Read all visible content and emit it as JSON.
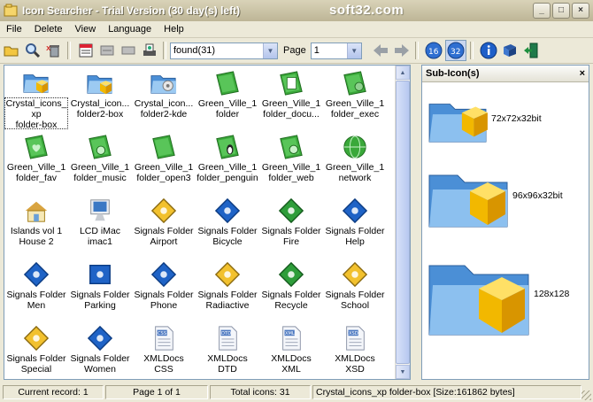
{
  "window": {
    "title": "Icon Searcher - Trial Version (30 day(s) left)",
    "watermark": "soft32.com"
  },
  "menu": [
    "File",
    "Delete",
    "View",
    "Language",
    "Help"
  ],
  "toolbar": {
    "filter_value": "found(31)",
    "page_label": "Page",
    "page_value": "1",
    "buttons": [
      "open-folder-icon",
      "search-icon",
      "delete-icon",
      "view-large-icon",
      "view-medium-icon",
      "view-small-icon",
      "scan-icon",
      "back-arrow-icon",
      "forward-arrow-icon",
      "size16-icon",
      "size32-icon",
      "info-icon",
      "help-book-icon",
      "exit-icon"
    ]
  },
  "icons": [
    {
      "label1": "Crystal_icons_",
      "label2": "xp",
      "label3": "folder-box",
      "kind": "crystal-box",
      "selected": true
    },
    {
      "label1": "Crystal_icon...",
      "label2": "folder2-box",
      "label3": "",
      "kind": "crystal-box2"
    },
    {
      "label1": "Crystal_icon...",
      "label2": "folder2-kde",
      "label3": "",
      "kind": "crystal-kde"
    },
    {
      "label1": "Green_Ville_1",
      "label2": "folder",
      "label3": "",
      "kind": "green-folder"
    },
    {
      "label1": "Green_Ville_1",
      "label2": "folder_docu...",
      "label3": "",
      "kind": "green-doc"
    },
    {
      "label1": "Green_Ville_1",
      "label2": "folder_exec",
      "label3": "",
      "kind": "green-exec"
    },
    {
      "label1": "Green_Ville_1",
      "label2": "folder_fav",
      "label3": "",
      "kind": "green-fav"
    },
    {
      "label1": "Green_Ville_1",
      "label2": "folder_music",
      "label3": "",
      "kind": "green-music"
    },
    {
      "label1": "Green_Ville_1",
      "label2": "folder_open3",
      "label3": "",
      "kind": "green-open"
    },
    {
      "label1": "Green_Ville_1",
      "label2": "folder_penguin",
      "label3": "",
      "kind": "green-penguin"
    },
    {
      "label1": "Green_Ville_1",
      "label2": "folder_web",
      "label3": "",
      "kind": "green-web"
    },
    {
      "label1": "Green_Ville_1",
      "label2": "network",
      "label3": "",
      "kind": "green-network"
    },
    {
      "label1": "Islands vol 1",
      "label2": "House 2",
      "label3": "",
      "kind": "house"
    },
    {
      "label1": "LCD iMac",
      "label2": "imac1",
      "label3": "",
      "kind": "imac"
    },
    {
      "label1": "Signals Folder",
      "label2": "Airport",
      "label3": "",
      "kind": "sig-yellow"
    },
    {
      "label1": "Signals Folder",
      "label2": "Bicycle",
      "label3": "",
      "kind": "sig-blue"
    },
    {
      "label1": "Signals Folder",
      "label2": "Fire",
      "label3": "",
      "kind": "sig-green"
    },
    {
      "label1": "Signals Folder",
      "label2": "Help",
      "label3": "",
      "kind": "sig-blue"
    },
    {
      "label1": "Signals Folder",
      "label2": "Men",
      "label3": "",
      "kind": "sig-blue"
    },
    {
      "label1": "Signals Folder",
      "label2": "Parking",
      "label3": "",
      "kind": "sig-bluesq"
    },
    {
      "label1": "Signals Folder",
      "label2": "Phone",
      "label3": "",
      "kind": "sig-blue"
    },
    {
      "label1": "Signals Folder",
      "label2": "Radiactive",
      "label3": "",
      "kind": "sig-yellow"
    },
    {
      "label1": "Signals Folder",
      "label2": "Recycle",
      "label3": "",
      "kind": "sig-green"
    },
    {
      "label1": "Signals Folder",
      "label2": "School",
      "label3": "",
      "kind": "sig-yellow"
    },
    {
      "label1": "Signals Folder",
      "label2": "Special",
      "label3": "",
      "kind": "sig-yellow"
    },
    {
      "label1": "Signals Folder",
      "label2": "Women",
      "label3": "",
      "kind": "sig-blue"
    },
    {
      "label1": "XMLDocs",
      "label2": "CSS",
      "label3": "",
      "kind": "doc",
      "tag": "CSS"
    },
    {
      "label1": "XMLDocs",
      "label2": "DTD",
      "label3": "",
      "kind": "doc",
      "tag": "DTD"
    },
    {
      "label1": "XMLDocs",
      "label2": "XML",
      "label3": "",
      "kind": "doc",
      "tag": "XML"
    },
    {
      "label1": "XMLDocs",
      "label2": "XSD",
      "label3": "",
      "kind": "doc",
      "tag": "XSD"
    }
  ],
  "subicons": {
    "title": "Sub-Icon(s)",
    "items": [
      {
        "label": "72x72x32bit"
      },
      {
        "label": "96x96x32bit"
      },
      {
        "label": "128x128"
      }
    ]
  },
  "status": {
    "record": "Current record: 1",
    "page": "Page 1 of 1",
    "total": "Total icons: 31",
    "info": "Crystal_icons_xp folder-box [Size:161862 bytes]"
  },
  "colors": {
    "accent": "#7f9db9",
    "folder_blue": "#5f9fd8",
    "box_yellow": "#f2b800",
    "green": "#3aa83a"
  }
}
